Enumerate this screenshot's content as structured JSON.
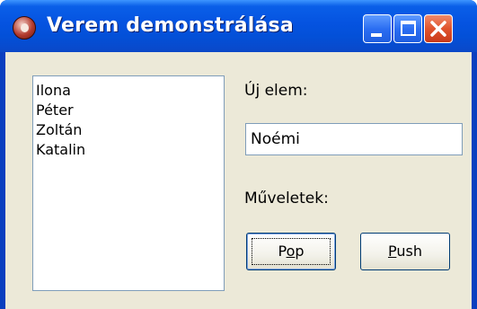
{
  "window": {
    "title": "Verem demonstrálása",
    "icon": "app-icon",
    "controls": [
      "minimize-icon",
      "maximize-icon",
      "close-icon"
    ]
  },
  "stack_list": {
    "items": [
      "Ilona",
      "Péter",
      "Zoltán",
      "Katalin"
    ]
  },
  "new_item": {
    "label": "Új elem:",
    "value": "Noémi"
  },
  "operations": {
    "label": "Műveletek:",
    "pop": {
      "accel": "o",
      "pre": "P",
      "post": "p"
    },
    "push": {
      "accel": "P",
      "pre": "",
      "post": "ush"
    }
  },
  "colors": {
    "titlebar": "#0553e0",
    "client_bg": "#ece9d8",
    "close_button": "#e0532d"
  }
}
